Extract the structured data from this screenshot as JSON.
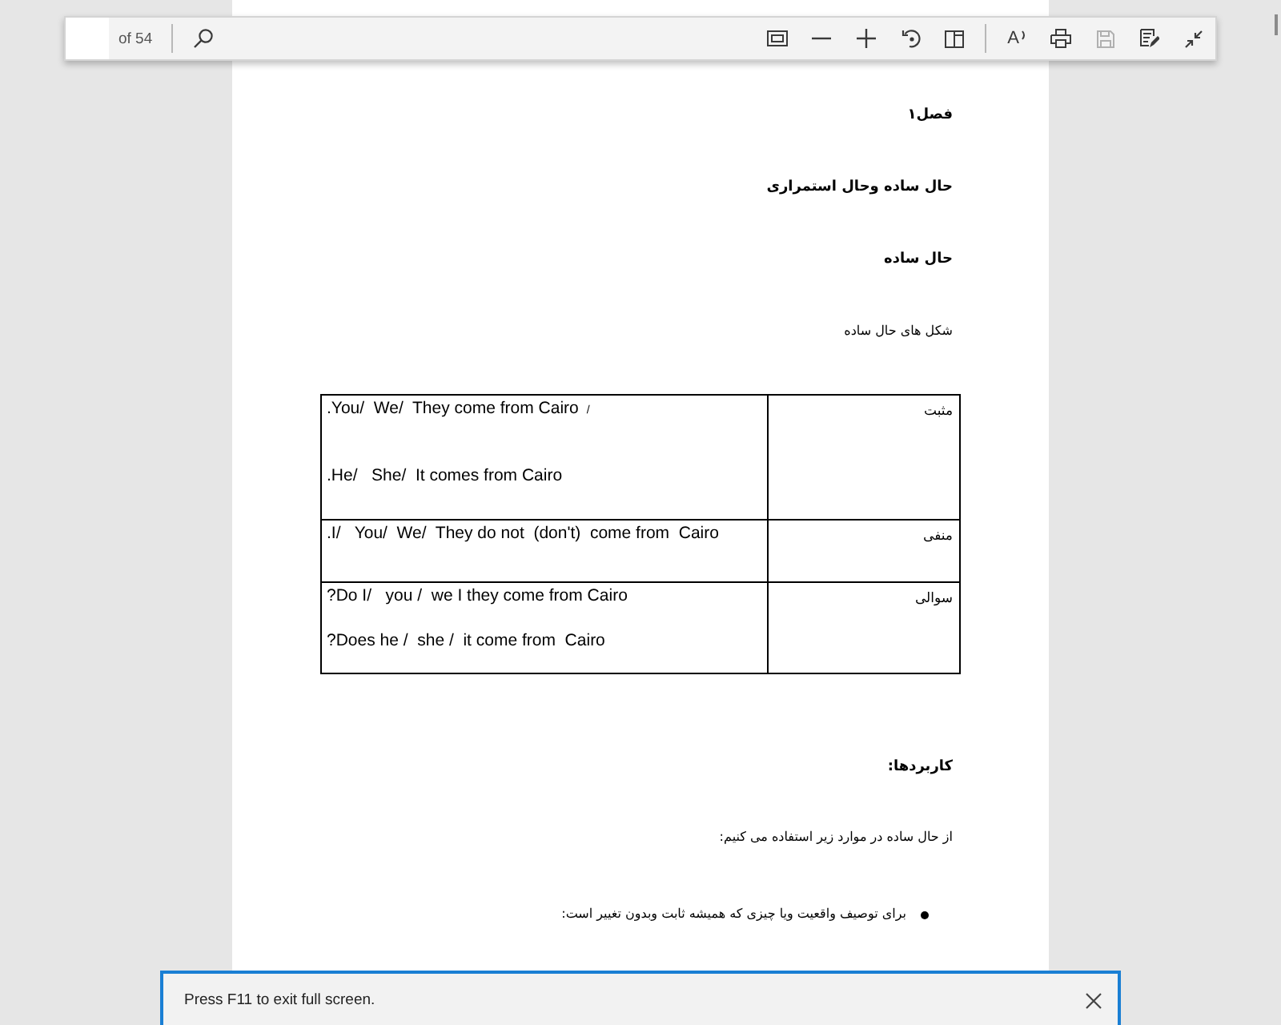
{
  "toolbar": {
    "page_field": {
      "of_label": "of 54"
    },
    "search_button": {
      "disabled": false
    },
    "view_buttons": [
      {
        "kind": "fit",
        "disabled": false
      },
      {
        "kind": "zoom_out",
        "disabled": false
      },
      {
        "kind": "zoom_in",
        "disabled": false
      },
      {
        "kind": "rotate",
        "disabled": false
      },
      {
        "kind": "page_view",
        "disabled": false
      }
    ],
    "tool_buttons": [
      {
        "kind": "read_aloud",
        "label": "A",
        "disabled": false
      },
      {
        "kind": "print",
        "disabled": false
      },
      {
        "kind": "save",
        "disabled": true
      },
      {
        "kind": "notes",
        "disabled": false
      },
      {
        "kind": "exit_full_screen",
        "disabled": false
      }
    ]
  },
  "document": {
    "blocks": [
      {
        "kind": "heading",
        "text": "فصل۱"
      },
      {
        "kind": "heading",
        "text": "حال ساده وحال استمراری"
      },
      {
        "kind": "heading",
        "text": "حال ساده"
      },
      {
        "kind": "paragraph",
        "text": "شکل های حال ساده"
      },
      {
        "kind": "table",
        "rows": [
          {
            "label": "مثبت",
            "lines": [
              {
                "text": ".You/  We/  They come from Cairo",
                "trailing": "/"
              },
              {
                "text": ".He/   She/  It comes from Cairo"
              }
            ]
          },
          {
            "label": "منفی",
            "lines": [
              {
                "text": ".I/   You/  We/  They do not  (don't)  come from  Cairo"
              }
            ]
          },
          {
            "label": "سوالی",
            "lines": [
              {
                "text": "?Do I/   you /  we I they come from Cairo"
              },
              {
                "text": "?Does he /  she /  it come from  Cairo"
              }
            ]
          }
        ]
      },
      {
        "kind": "heading",
        "text": "کاربردها:"
      },
      {
        "kind": "paragraph",
        "text": "از حال ساده در موارد زیر استفاده می کنیم:"
      },
      {
        "kind": "bullet",
        "text": "برای توصیف واقعیت ویا چیزی که همیشه ثابت وبدون تغییر است:"
      }
    ]
  },
  "notification": {
    "text": "Press F11 to exit full screen."
  }
}
